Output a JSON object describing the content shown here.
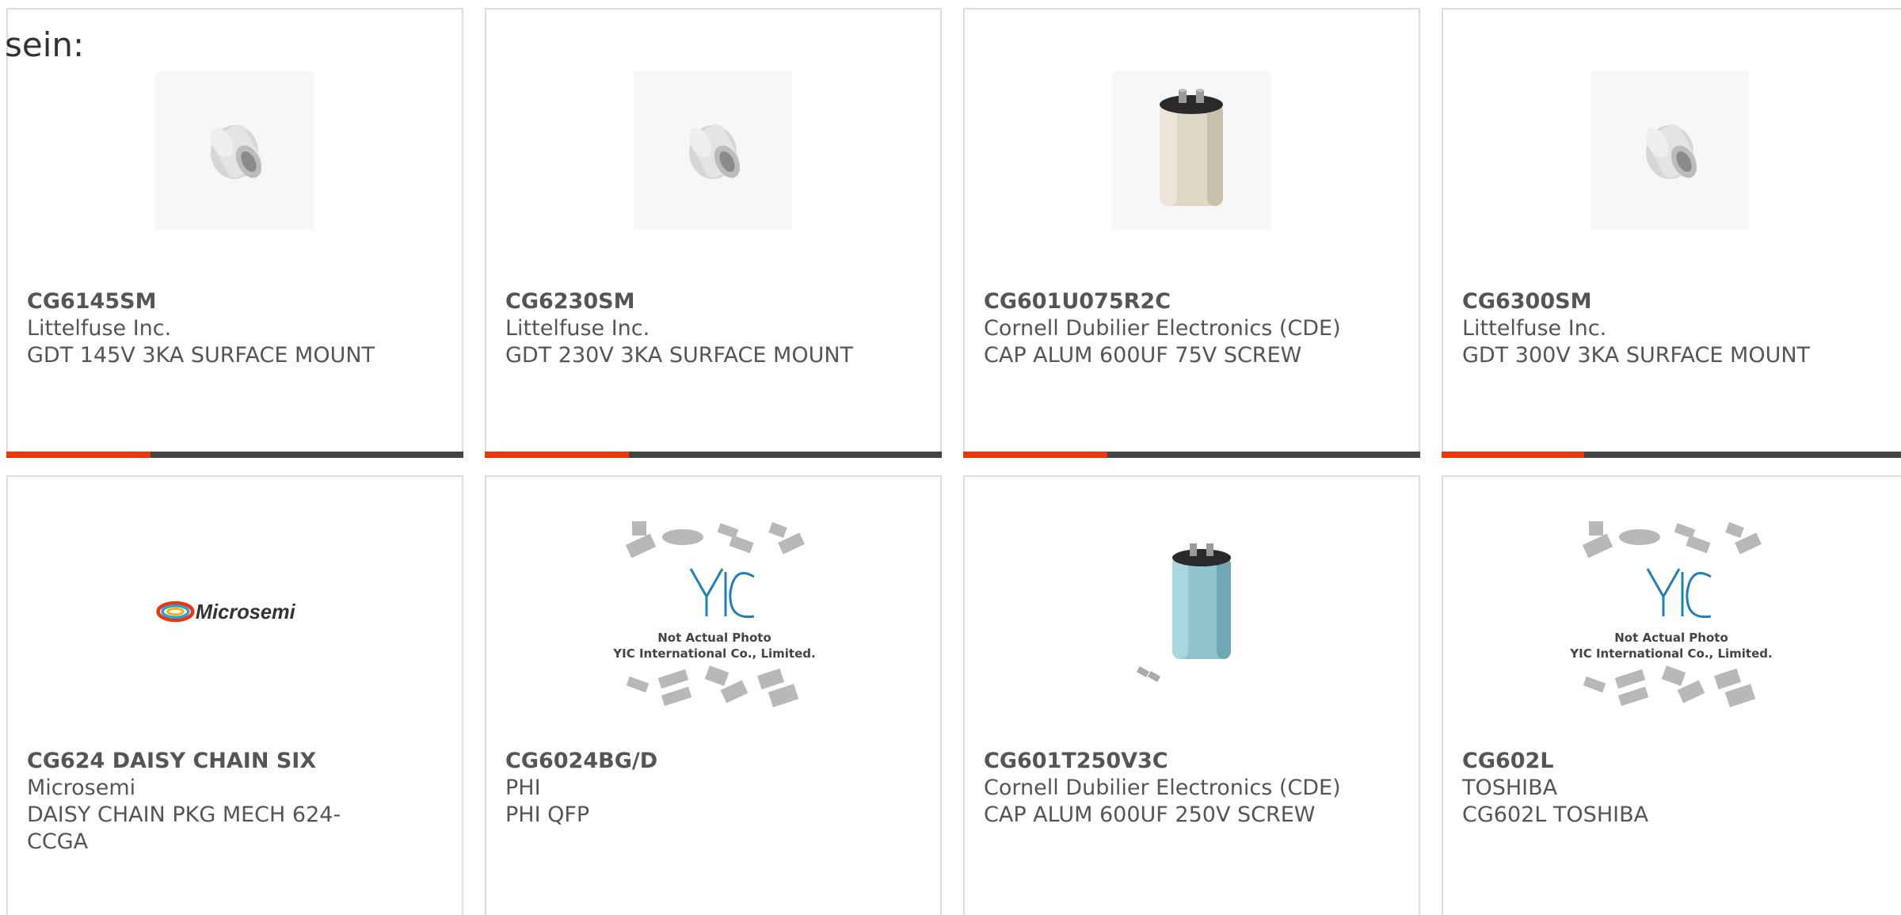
{
  "intro": {
    "text": "sein:"
  },
  "colors": {
    "accent": "#e8380d",
    "bar_track": "#444444",
    "card_border": "#dcdcdc",
    "text": "#555555"
  },
  "products": [
    {
      "part_number": "CG6145SM",
      "manufacturer": "Littelfuse Inc.",
      "description": "GDT 145V 3KA SURFACE MOUNT",
      "image": "gas-discharge-tube-image",
      "progress": 0.315
    },
    {
      "part_number": "CG6230SM",
      "manufacturer": "Littelfuse Inc.",
      "description": "GDT 230V 3KA SURFACE MOUNT",
      "image": "gas-discharge-tube-image",
      "progress": 0.315
    },
    {
      "part_number": "CG601U075R2C",
      "manufacturer": "Cornell Dubilier Electronics (CDE)",
      "description": "CAP ALUM 600UF 75V SCREW",
      "image": "capacitor-image",
      "progress": 0.315
    },
    {
      "part_number": "CG6300SM",
      "manufacturer": "Littelfuse Inc.",
      "description": "GDT 300V 3KA SURFACE MOUNT",
      "image": "gas-discharge-tube-image",
      "progress": 0.315
    },
    {
      "part_number": "CG624 DAISY CHAIN SIX",
      "manufacturer": "Microsemi",
      "description": "DAISY CHAIN PKG MECH 624-CCGA",
      "image": "microsemi-logo",
      "logo_text": "Microsemi"
    },
    {
      "part_number": "CG6024BG/D",
      "manufacturer": "PHI",
      "description": "PHI QFP",
      "image": "placeholder-chips-image",
      "placeholder_line1": "Not Actual Photo",
      "placeholder_line2": "YIC International Co., Limited."
    },
    {
      "part_number": "CG601T250V3C",
      "manufacturer": "Cornell Dubilier Electronics (CDE)",
      "description": "CAP ALUM 600UF 250V SCREW",
      "image": "capacitor-image"
    },
    {
      "part_number": "CG602L",
      "manufacturer": "TOSHIBA",
      "description": "CG602L TOSHIBA",
      "image": "placeholder-chips-image",
      "placeholder_line1": "Not Actual Photo",
      "placeholder_line2": "YIC International Co., Limited."
    }
  ]
}
